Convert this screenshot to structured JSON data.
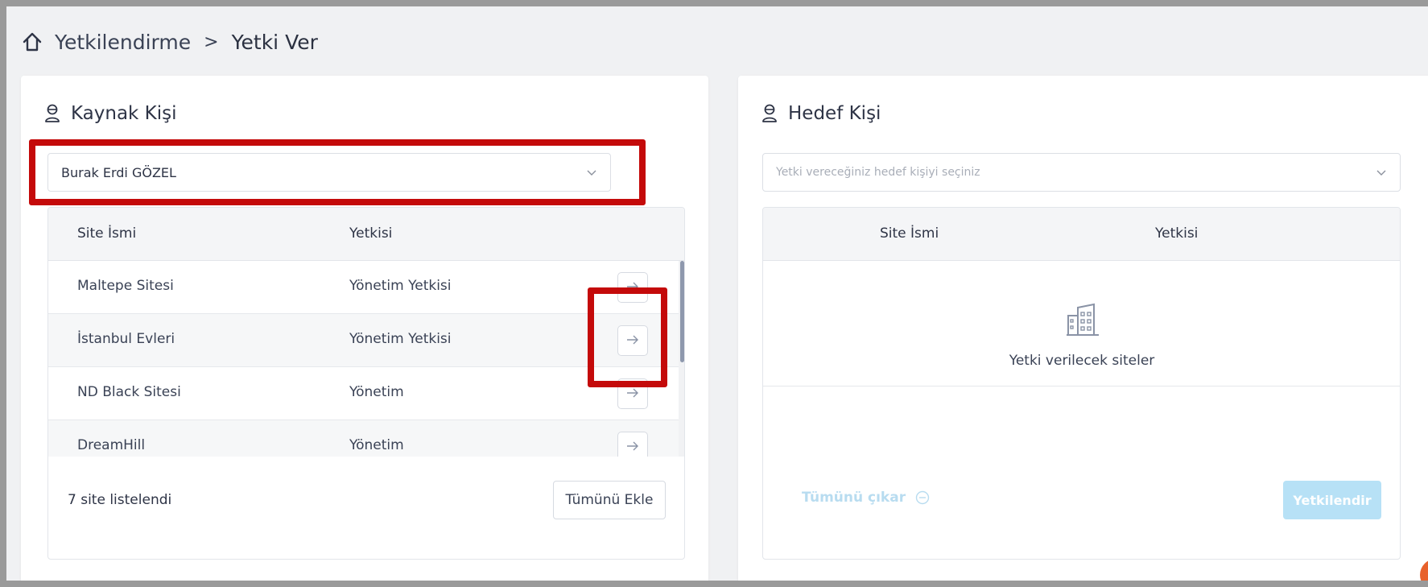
{
  "breadcrumb": {
    "home_icon": "home-icon",
    "parent": "Yetkilendirme",
    "separator": ">",
    "current": "Yetki Ver"
  },
  "source": {
    "title": "Kaynak Kişi",
    "title_icon": "user-icon",
    "select_value": "Burak Erdi GÖZEL",
    "columns": [
      "Site İsmi",
      "Yetkisi"
    ],
    "rows": [
      {
        "site": "Maltepe Sitesi",
        "role": "Yönetim Yetkisi"
      },
      {
        "site": "İstanbul Evleri",
        "role": "Yönetim Yetkisi"
      },
      {
        "site": "ND Black Sitesi",
        "role": "Yönetim"
      },
      {
        "site": "DreamHill",
        "role": "Yönetim"
      }
    ],
    "footer_count": "7 site listelendi",
    "add_all_label": "Tümünü Ekle"
  },
  "target": {
    "title": "Hedef Kişi",
    "title_icon": "user-icon",
    "select_placeholder": "Yetki vereceğiniz hedef kişiyi seçiniz",
    "columns": [
      "Site İsmi",
      "Yetkisi"
    ],
    "empty_icon": "building-icon",
    "empty_text": "Yetki verilecek siteler",
    "remove_all_label": "Tümünü çıkar",
    "authorize_label": "Yetkilendir"
  },
  "colors": {
    "highlight": "#c40a0a",
    "primary_disabled": "#b7e1f6",
    "link_disabled": "#b8dcf0"
  }
}
